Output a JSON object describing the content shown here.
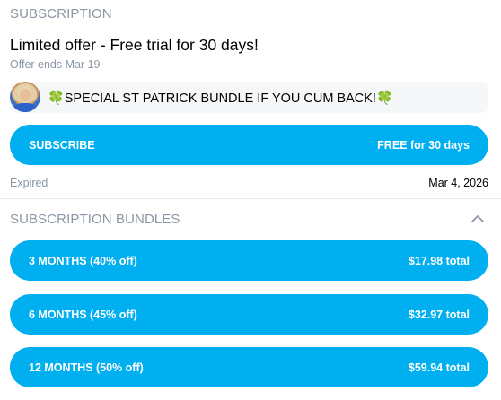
{
  "subscription": {
    "section_title": "SUBSCRIPTION",
    "offer_title": "Limited offer - Free trial for 30 days!",
    "offer_ends": "Offer ends Mar 19",
    "message": {
      "clover_left": "🍀",
      "text": "SPECIAL ST PATRICK BUNDLE IF YOU CUM BACK!",
      "clover_right": "🍀"
    },
    "subscribe_button": {
      "label": "SUBSCRIBE",
      "price": "FREE for 30 days"
    },
    "status": "Expired",
    "status_date": "Mar 4, 2026"
  },
  "bundles": {
    "section_title": "SUBSCRIPTION BUNDLES",
    "items": [
      {
        "label": "3 MONTHS (40% off)",
        "price": "$17.98 total"
      },
      {
        "label": "6 MONTHS (45% off)",
        "price": "$32.97 total"
      },
      {
        "label": "12 MONTHS (50% off)",
        "price": "$59.94 total"
      }
    ]
  },
  "colors": {
    "accent": "#00aff0",
    "muted_text": "#8a96a3",
    "message_bg": "#f6f7f8"
  },
  "icons": {
    "avatar": "avatar",
    "collapse": "chevron-up-icon",
    "clover": "clover-icon"
  }
}
